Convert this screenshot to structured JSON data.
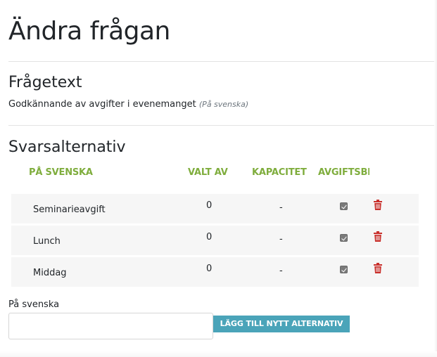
{
  "page": {
    "title": "Ändra frågan"
  },
  "question": {
    "heading": "Frågetext",
    "text": "Godkännande av avgifter i evenemanget",
    "language_note": "(På svenska)"
  },
  "answers": {
    "heading": "Svarsalternativ",
    "columns": {
      "name": "PÅ SVENSKA",
      "selected_by": "VALT AV",
      "capacity": "KAPACITET",
      "fee": "AVGIFTSBELAGD"
    },
    "rows": [
      {
        "name": "Seminarieavgift",
        "selected_by": "0",
        "capacity": "-",
        "fee": true
      },
      {
        "name": "Lunch",
        "selected_by": "0",
        "capacity": "-",
        "fee": true
      },
      {
        "name": "Middag",
        "selected_by": "0",
        "capacity": "-",
        "fee": true
      }
    ]
  },
  "new_option": {
    "label": "På svenska",
    "value": "",
    "button_label": "LÄGG TILL NYTT ALTERNATIV"
  },
  "colors": {
    "header_green": "#7fad3d",
    "delete_red": "#c9302c",
    "button_blue": "#4aa4b9",
    "row_background": "#f6f6f6"
  },
  "icons": {
    "delete": "trash-icon",
    "fee_checkbox": "checkbox-checked-icon"
  }
}
